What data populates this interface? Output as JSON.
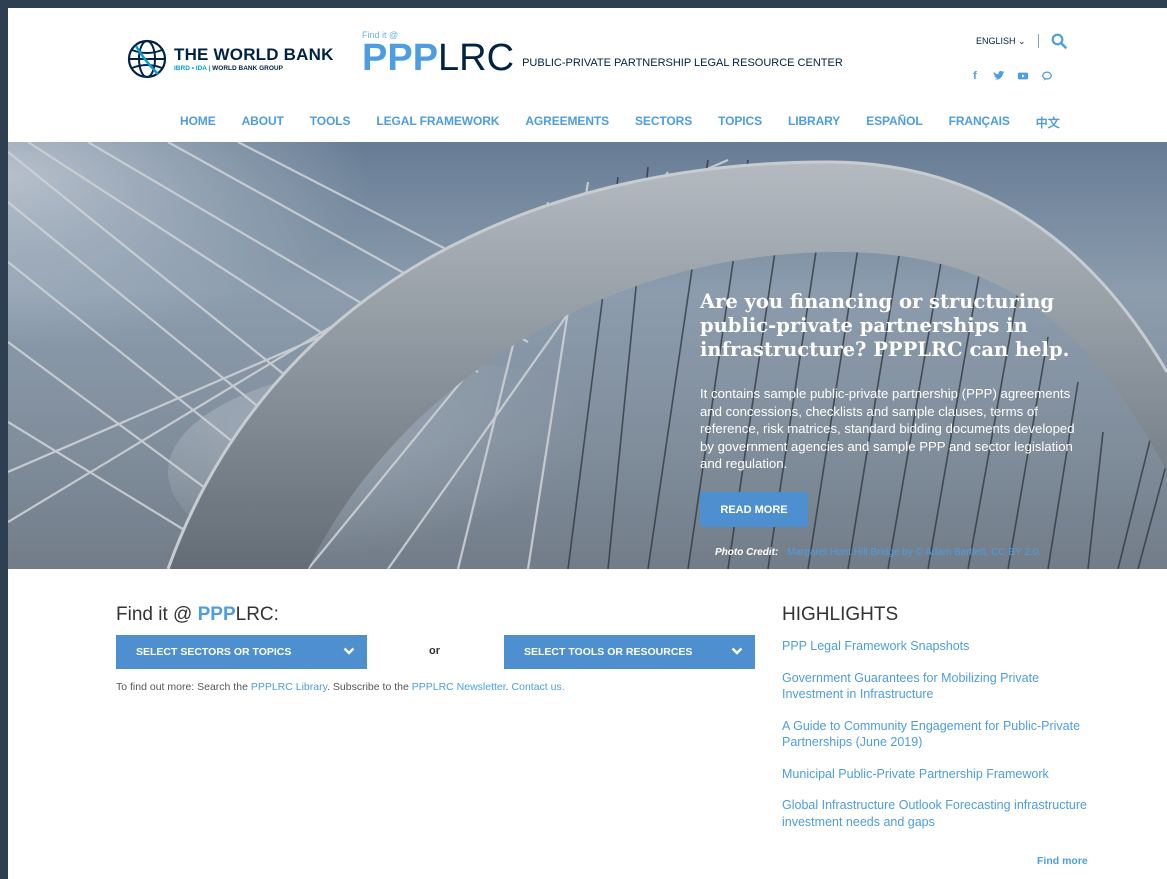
{
  "header": {
    "wb_title": "THE WORLD BANK",
    "wb_sub_ibrd": "IBRD • IDA",
    "wb_sub_group": "WORLD BANK GROUP",
    "brand_findit": "Find it @",
    "brand_ppp": "PPP",
    "brand_lrc": "LRC",
    "brand_full": "PUBLIC-PRIVATE PARTNERSHIP LEGAL RESOURCE CENTER",
    "language": "ENGLISH",
    "social": [
      "f",
      "t",
      "yt",
      "chat"
    ]
  },
  "nav": [
    "HOME",
    "ABOUT",
    "TOOLS",
    "LEGAL FRAMEWORK",
    "AGREEMENTS",
    "SECTORS",
    "TOPICS",
    "LIBRARY",
    "ESPAÑOL",
    "FRANÇAIS",
    "中文"
  ],
  "hero": {
    "headline": "Are you financing or structuring public-private partnerships in infrastructure? PPPLRC can help.",
    "body": "It contains sample public-private partnership (PPP) agreements and concessions, checklists and sample clauses, terms of reference, risk matrices, standard bidding documents developed by government agencies and sample PPP and sector legislation and regulation.",
    "button": "READ MORE",
    "credit_label": "Photo Credit:",
    "credit_link": "Margaret Hunt Hill Bridge by © Adam Bartlett, CC BY 2.0."
  },
  "findit": {
    "title_prefix": "Find it @ ",
    "title_ppp": "PPP",
    "title_lrc": "LRC:",
    "select_sectors": "SELECT SECTORS OR TOPICS",
    "or": "or",
    "select_tools": "SELECT TOOLS OR RESOURCES",
    "more_prefix": "To find out more: Search the ",
    "more_library": "PPPLRC Library",
    "more_mid": ". Subscribe to the ",
    "more_newsletter": "PPPLRC Newsletter",
    "more_sep": ". ",
    "more_contact": "Contact us."
  },
  "highlights": {
    "title": "HIGHLIGHTS",
    "items": [
      "PPP Legal Framework Snapshots",
      "Government Guarantees for Mobilizing Private Investment in Infrastructure",
      "A Guide to Community Engagement for Public-Private Partnerships (June 2019)",
      "Municipal Public-Private Partnership Framework",
      "Global Infrastructure Outlook Forecasting infrastructure investment needs and gaps"
    ],
    "find_more": "Find more"
  },
  "colors": {
    "accent": "#4d9de0",
    "button": "#4d8fcf",
    "navy": "#002244",
    "frame": "#2e3f52"
  }
}
